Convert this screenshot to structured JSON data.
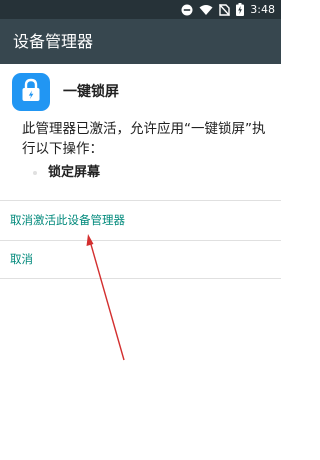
{
  "status_bar": {
    "time": "3:48",
    "icons": [
      "do-not-disturb-icon",
      "wifi-icon",
      "no-sim-icon",
      "battery-charging-icon"
    ]
  },
  "app_bar": {
    "title": "设备管理器"
  },
  "admin": {
    "app_icon": "lock-icon",
    "app_name": "一键锁屏",
    "description": "此管理器已激活，允许应用“一键锁屏”执行以下操作：",
    "policies": [
      "锁定屏幕"
    ]
  },
  "actions": {
    "deactivate": "取消激活此设备管理器",
    "cancel": "取消"
  },
  "colors": {
    "status_bar": "#263238",
    "app_bar": "#37474f",
    "accent": "#00897b",
    "app_icon_bg": "#2196f3",
    "annotation_arrow": "#d32f2f"
  }
}
